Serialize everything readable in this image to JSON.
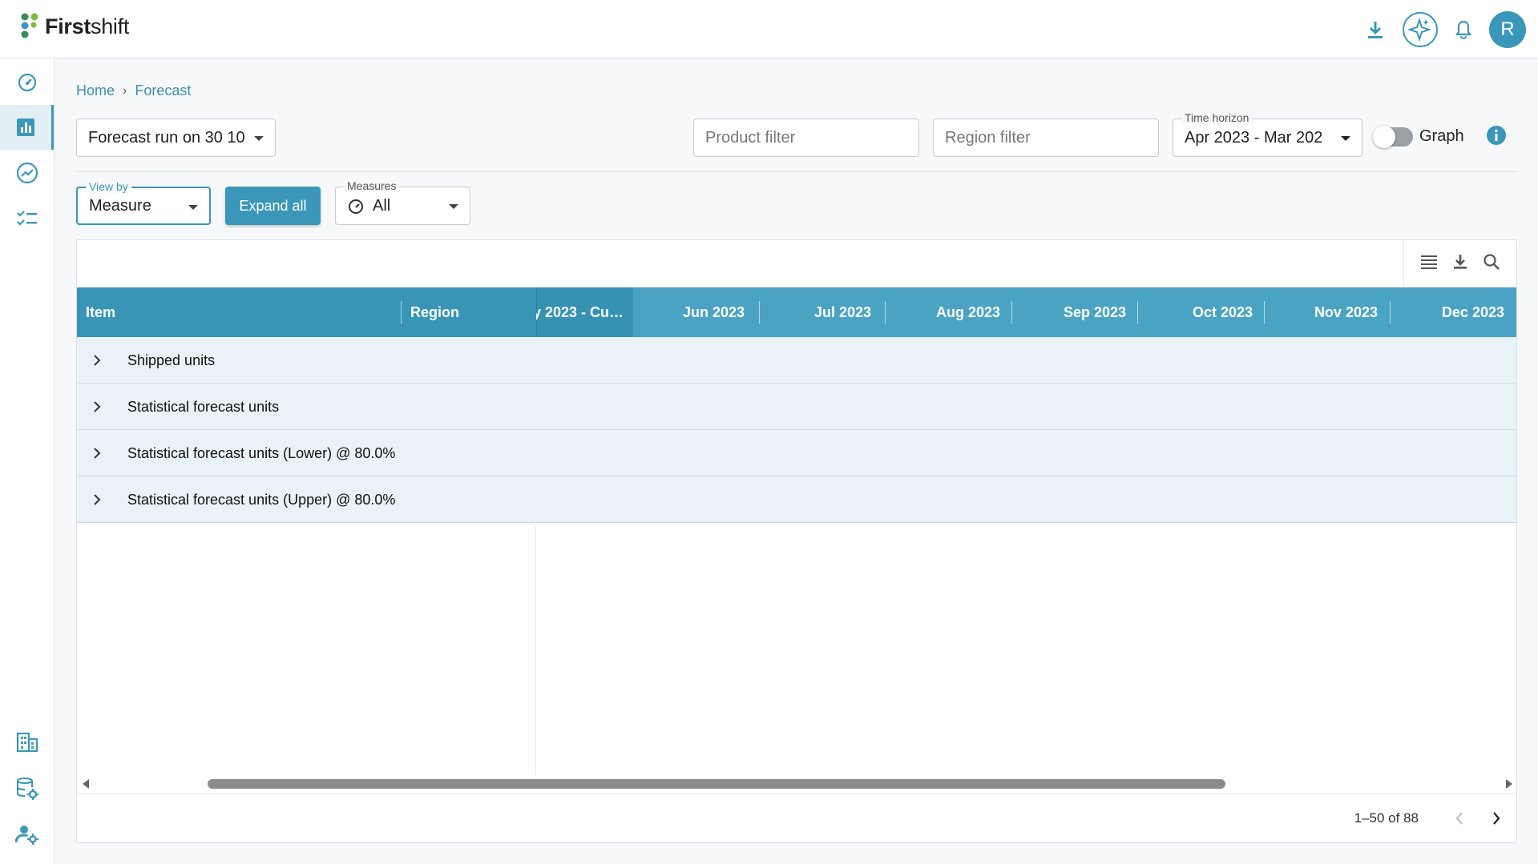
{
  "app": {
    "logo_bold": "First",
    "logo_light": "shift"
  },
  "topbar": {
    "icons": [
      "download-icon",
      "ai-sparkle-icon",
      "bell-icon"
    ],
    "avatar_initial": "R"
  },
  "sidebar": {
    "items": [
      {
        "icon": "dashboard-gauge-icon",
        "active": false
      },
      {
        "icon": "bar-chart-icon",
        "active": true
      },
      {
        "icon": "trend-chart-icon",
        "active": false
      },
      {
        "icon": "checklist-icon",
        "active": false
      }
    ],
    "bottom_items": [
      {
        "icon": "building-icon"
      },
      {
        "icon": "database-settings-icon"
      },
      {
        "icon": "user-settings-icon"
      }
    ]
  },
  "breadcrumb": {
    "home": "Home",
    "current": "Forecast",
    "separator": "›"
  },
  "filters": {
    "forecast_run": "Forecast run on 30 10",
    "product_placeholder": "Product filter",
    "region_placeholder": "Region filter",
    "time_horizon_label": "Time horizon",
    "time_horizon_value": "Apr 2023 - Mar 202",
    "graph_toggle_label": "Graph",
    "graph_toggle_on": false
  },
  "controls": {
    "view_by_label": "View by",
    "view_by_value": "Measure",
    "expand_all_label": "Expand all",
    "measures_label": "Measures",
    "measures_value": "All"
  },
  "grid": {
    "toolbar_icons": [
      "columns-menu-icon",
      "download-icon",
      "search-icon"
    ],
    "columns": {
      "item": "Item",
      "region": "Region",
      "current": "y 2023 - Cu…",
      "months": [
        "Jun 2023",
        "Jul 2023",
        "Aug 2023",
        "Sep 2023",
        "Oct 2023",
        "Nov 2023",
        "Dec 2023"
      ]
    },
    "rows": [
      {
        "label": "Shipped units"
      },
      {
        "label": "Statistical forecast units"
      },
      {
        "label": "Statistical forecast units (Lower) @ 80.0%"
      },
      {
        "label": "Statistical forecast units (Upper) @ 80.0%"
      }
    ],
    "pagination": {
      "range": "1–50 of 88"
    }
  },
  "colors": {
    "accent": "#3a97b9",
    "header_bg": "#4aa3c3",
    "row_bg": "#e9f2f7"
  }
}
